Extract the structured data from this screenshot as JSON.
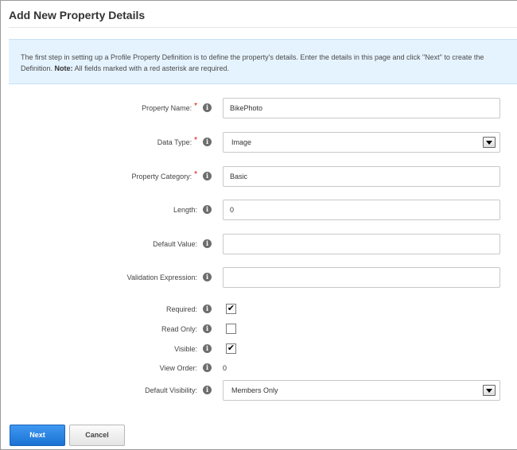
{
  "page": {
    "title": "Add New Property Details"
  },
  "info": {
    "line1": "The first step in setting up a Profile Property Definition is to define the property's details. Enter the details in this page and click \"Next\" to create the",
    "line2_prefix": "Definition.",
    "note_label": "Note:",
    "note_text": "All fields marked with a red asterisk are required."
  },
  "form": {
    "property_name": {
      "label": "Property Name:",
      "required_mark": "*",
      "value": "BikePhoto"
    },
    "data_type": {
      "label": "Data Type:",
      "required_mark": "*",
      "value": "Image"
    },
    "property_category": {
      "label": "Property Category:",
      "required_mark": "*",
      "value": "Basic"
    },
    "length": {
      "label": "Length:",
      "value": "0"
    },
    "default_value": {
      "label": "Default Value:",
      "value": ""
    },
    "validation_expression": {
      "label": "Validation Expression:",
      "value": ""
    },
    "required": {
      "label": "Required:",
      "checked": true,
      "check_glyph": "✔"
    },
    "read_only": {
      "label": "Read Only:",
      "checked": false,
      "check_glyph": ""
    },
    "visible": {
      "label": "Visible:",
      "checked": true,
      "check_glyph": "✔"
    },
    "view_order": {
      "label": "View Order:",
      "value": "0"
    },
    "default_visibility": {
      "label": "Default Visibility:",
      "value": "Members Only"
    }
  },
  "help_icon": {
    "glyph": "i",
    "name": "info-icon"
  },
  "buttons": {
    "next": "Next",
    "cancel": "Cancel"
  },
  "colors": {
    "primary_button": "#1b72d4",
    "info_background": "#e5f3ff",
    "required_star": "#e00000"
  }
}
